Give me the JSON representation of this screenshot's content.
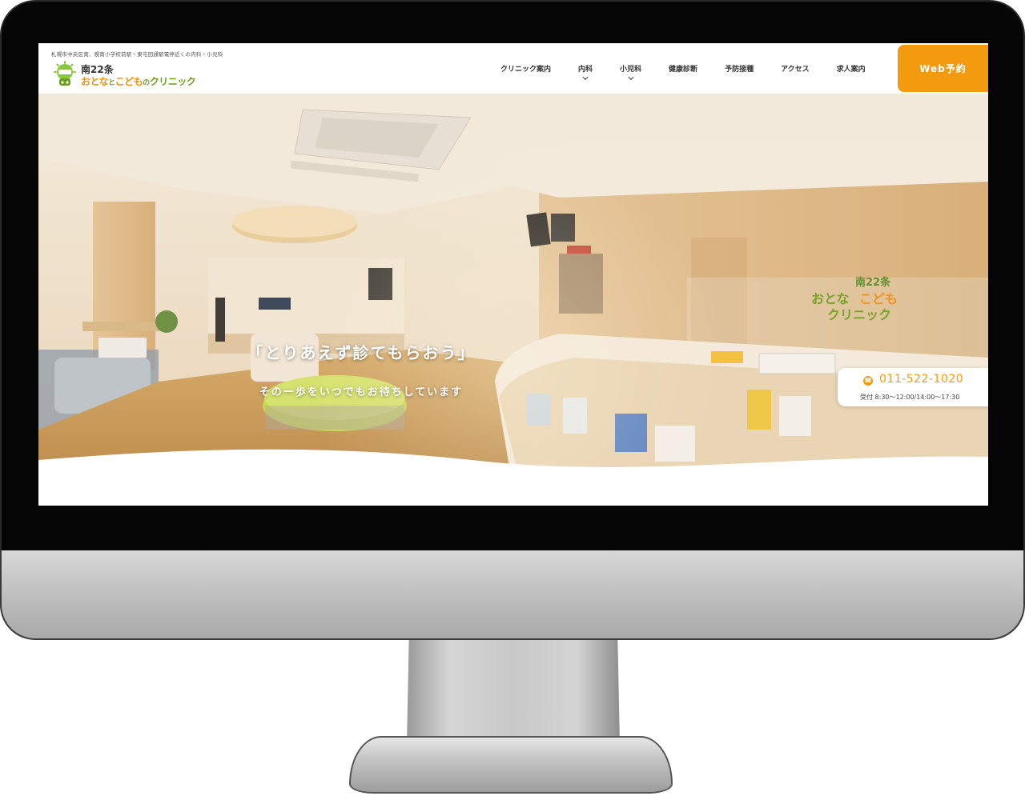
{
  "header": {
    "tagline": "札幌市中央区南、幌南小学校前駅・東屯田通駅電停近くの内科・小児科",
    "logo_line1": "南22条",
    "logo_line2_a": "おとな",
    "logo_line2_b": "と",
    "logo_line2_c": "こども",
    "logo_line2_d": "の",
    "logo_line2_e": "クリニック"
  },
  "nav": {
    "items": [
      {
        "label": "クリニック案内",
        "has_dropdown": false
      },
      {
        "label": "内科",
        "has_dropdown": true
      },
      {
        "label": "小児科",
        "has_dropdown": true
      },
      {
        "label": "健康診断",
        "has_dropdown": false
      },
      {
        "label": "予防接種",
        "has_dropdown": false
      },
      {
        "label": "アクセス",
        "has_dropdown": false
      },
      {
        "label": "求人案内",
        "has_dropdown": false
      }
    ],
    "cta_label": "Web予約"
  },
  "hero": {
    "title": "「とりあえず診てもらおう」",
    "subtitle": "その一歩をいつでもお待ちしています",
    "background": "clinic-reception-photo"
  },
  "contact": {
    "phone_icon": "phone-icon",
    "phone": "011-522-1020",
    "hours": "受付 8:30〜12:00/14:00〜17:30"
  },
  "colors": {
    "accent": "#f39a0f",
    "brand_green": "#6a9f1e",
    "bezel": "#050505"
  }
}
